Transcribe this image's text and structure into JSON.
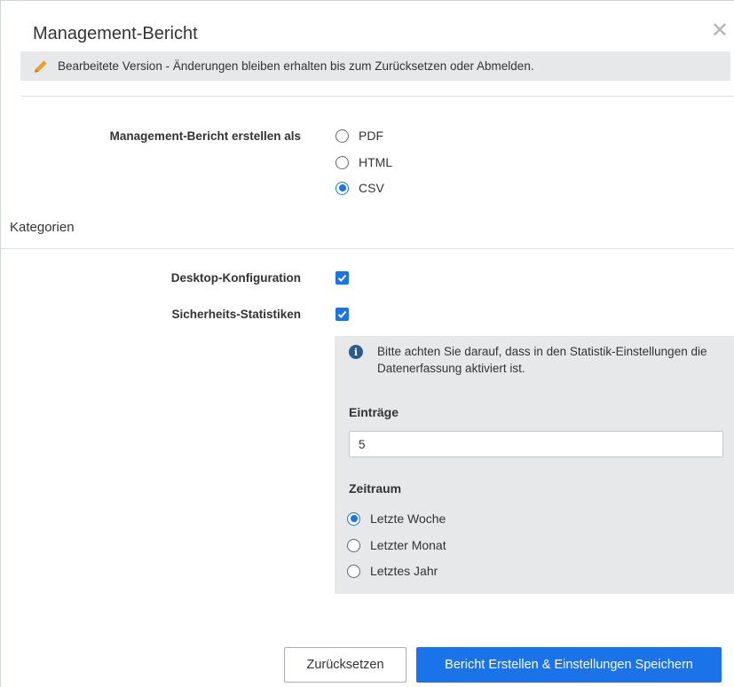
{
  "dialog": {
    "title": "Management-Bericht",
    "close_symbol": "✕",
    "notice": "Bearbeitete Version - Änderungen bleiben erhalten bis zum Zurücksetzen oder Abmelden."
  },
  "format": {
    "label": "Management-Bericht erstellen als",
    "options": [
      {
        "label": "PDF",
        "selected": false
      },
      {
        "label": "HTML",
        "selected": false
      },
      {
        "label": "CSV",
        "selected": true
      }
    ]
  },
  "categories": {
    "title": "Kategorien",
    "items": [
      {
        "label": "Desktop-Konfiguration",
        "checked": true
      },
      {
        "label": "Sicherheits-Statistiken",
        "checked": true
      }
    ]
  },
  "statistics_panel": {
    "info": "Bitte achten Sie darauf, dass in den Statistik-Einstellungen die Datenerfassung aktiviert ist.",
    "entries_label": "Einträge",
    "entries_value": "5",
    "period_label": "Zeitraum",
    "period_options": [
      {
        "label": "Letzte Woche",
        "selected": true
      },
      {
        "label": "Letzter Monat",
        "selected": false
      },
      {
        "label": "Letztes Jahr",
        "selected": false
      }
    ]
  },
  "buttons": {
    "reset": "Zurücksetzen",
    "submit": "Bericht Erstellen & Einstellungen Speichern"
  },
  "colors": {
    "accent": "#1a73e8",
    "notice_bg": "#e6e8ea",
    "pencil": "#f0a020",
    "info_icon": "#2c5c8c"
  },
  "icons": {
    "notice": "pencil-icon",
    "close": "close-icon",
    "info": "info-icon"
  }
}
